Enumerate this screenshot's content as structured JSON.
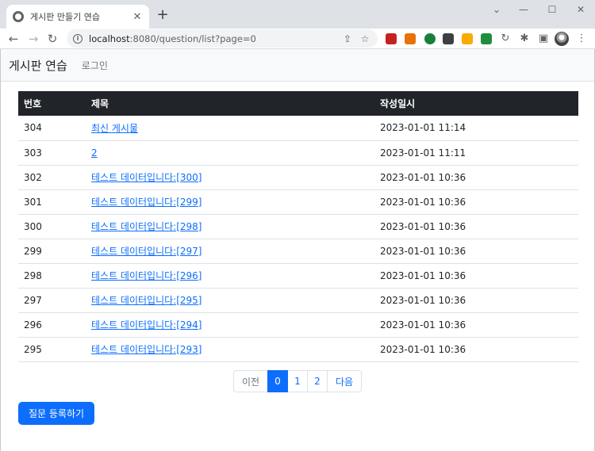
{
  "browser": {
    "tab_title": "게시판 만들기 연습",
    "tab_close": "✕",
    "new_tab": "+",
    "url_host": "localhost",
    "url_path": ":8080/question/list?page=0",
    "window_controls": [
      "⌄",
      "—",
      "☐",
      "✕"
    ]
  },
  "navbar": {
    "brand": "게시판 연습",
    "login": "로그인"
  },
  "table": {
    "headers": [
      "번호",
      "제목",
      "작성일시"
    ],
    "rows": [
      {
        "no": "304",
        "title": "최신 게시물",
        "date": "2023-01-01 11:14"
      },
      {
        "no": "303",
        "title": "2",
        "date": "2023-01-01 11:11"
      },
      {
        "no": "302",
        "title": "테스트 데이터입니다:[300]",
        "date": "2023-01-01 10:36"
      },
      {
        "no": "301",
        "title": "테스트 데이터입니다:[299]",
        "date": "2023-01-01 10:36"
      },
      {
        "no": "300",
        "title": "테스트 데이터입니다:[298]",
        "date": "2023-01-01 10:36"
      },
      {
        "no": "299",
        "title": "테스트 데이터입니다:[297]",
        "date": "2023-01-01 10:36"
      },
      {
        "no": "298",
        "title": "테스트 데이터입니다:[296]",
        "date": "2023-01-01 10:36"
      },
      {
        "no": "297",
        "title": "테스트 데이터입니다:[295]",
        "date": "2023-01-01 10:36"
      },
      {
        "no": "296",
        "title": "테스트 데이터입니다:[294]",
        "date": "2023-01-01 10:36"
      },
      {
        "no": "295",
        "title": "테스트 데이터입니다:[293]",
        "date": "2023-01-01 10:36"
      }
    ]
  },
  "pagination": {
    "prev": "이전",
    "pages": [
      "0",
      "1",
      "2"
    ],
    "active_page": "0",
    "next": "다음"
  },
  "actions": {
    "create_question": "질문 등록하기"
  },
  "colors": {
    "primary": "#0d6efd",
    "table_header_bg": "#212529",
    "navbar_bg": "#f8f9fa"
  }
}
